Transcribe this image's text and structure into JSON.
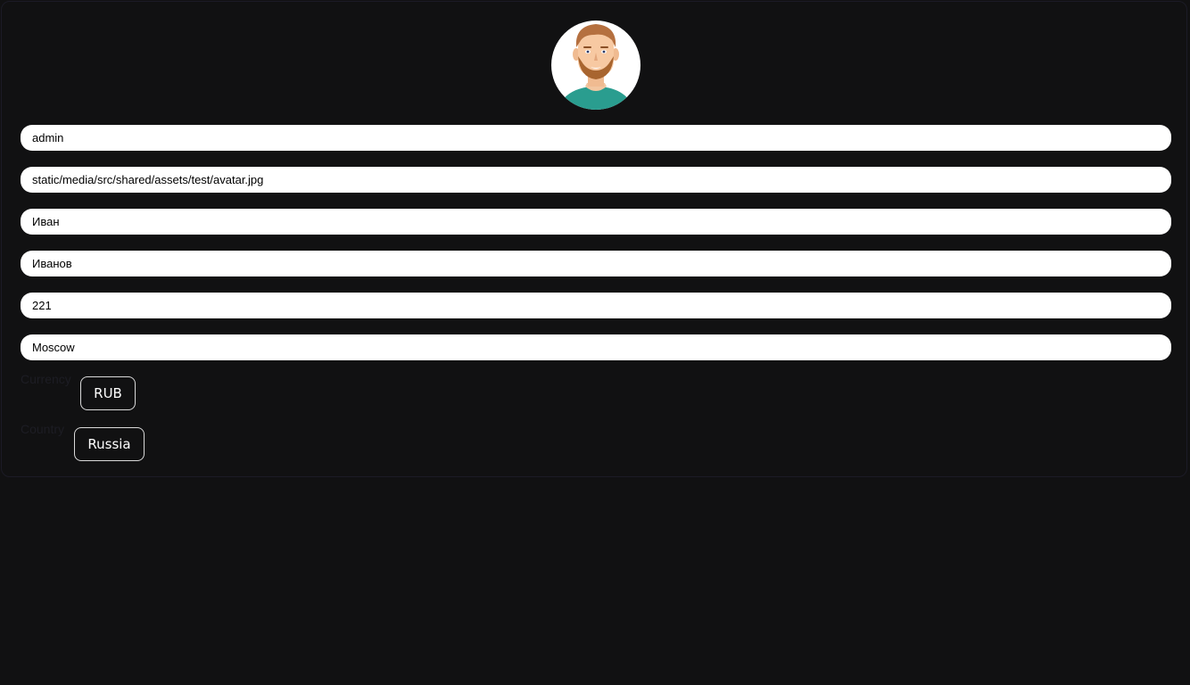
{
  "profile": {
    "avatar_icon": "user-avatar-icon",
    "fields": {
      "username": "admin",
      "avatar_path": "static/media/src/shared/assets/test/avatar.jpg",
      "first_name": "Иван",
      "last_name": "Иванов",
      "age": "221",
      "city": "Moscow"
    },
    "currency": {
      "label": "Currency",
      "value": "RUB"
    },
    "country": {
      "label": "Country",
      "value": "Russia"
    }
  },
  "colors": {
    "background": "#111112",
    "field_background": "#ffffff",
    "shirt": "#2a9d8f",
    "hair": "#b5703f"
  }
}
